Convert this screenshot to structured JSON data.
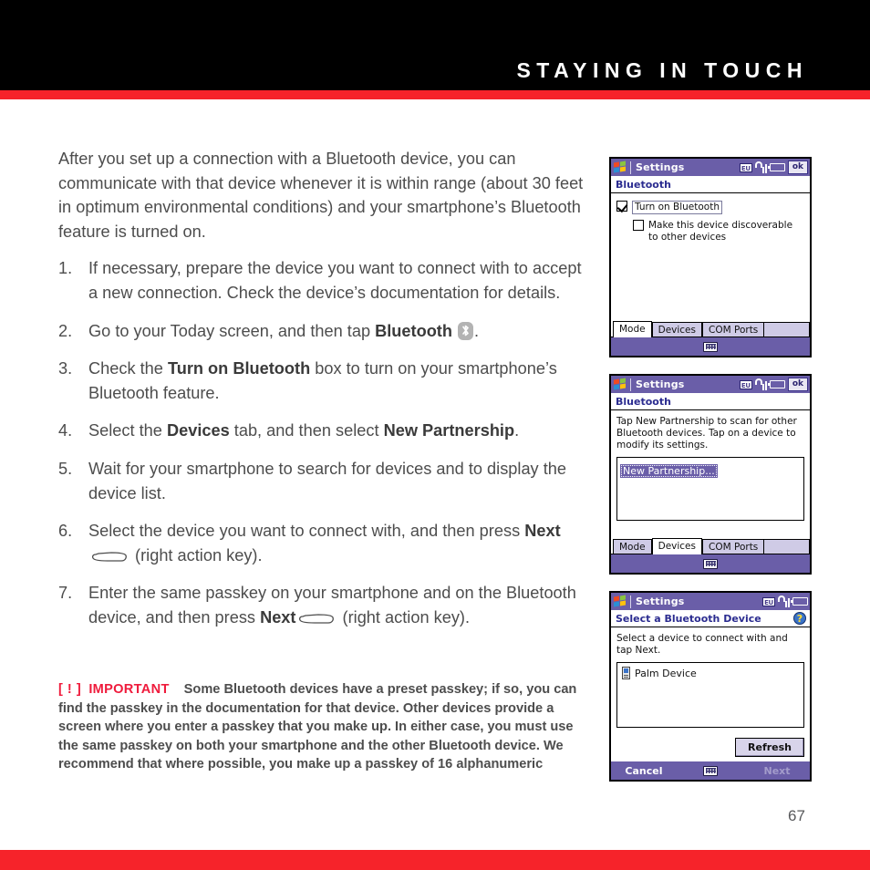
{
  "header": {
    "title": "STAYING IN TOUCH"
  },
  "footer": {
    "page_number": "67"
  },
  "colors": {
    "accent_red": "#f6232a",
    "note_red": "#ef1b3c",
    "pda_purple": "#6a5ea8",
    "body_gray": "#4d4d4d"
  },
  "body": {
    "intro": "After you set up a connection with a Bluetooth device, you can communicate with that device whenever it is within range (about 30 feet in optimum environmental conditions) and your smartphone’s Bluetooth feature is turned on.",
    "steps": [
      {
        "num": "1.",
        "part1": "If necessary, prepare the device you want to connect with to accept a new connection. Check the device’s documentation for details."
      },
      {
        "num": "2.",
        "part1": "Go to your Today screen, and then tap ",
        "bold1": "Bluetooth",
        "icon": "bluetooth-icon",
        "part2": "."
      },
      {
        "num": "3.",
        "part1": "Check the ",
        "bold1": "Turn on Bluetooth",
        "part2": " box to turn on your smartphone’s Bluetooth feature."
      },
      {
        "num": "4.",
        "part1": "Select the ",
        "bold1": "Devices",
        "part2": " tab, and then select ",
        "bold2": "New Partnership",
        "part3": "."
      },
      {
        "num": "5.",
        "part1": "Wait for your smartphone to search for devices and to display the device list."
      },
      {
        "num": "6.",
        "part1": "Select the device you want to connect with, and then press ",
        "bold1": "Next",
        "icon": "action-key-icon",
        "part2": " (right action key)."
      },
      {
        "num": "7.",
        "part1": "Enter the same passkey on your smartphone and on the Bluetooth device, and then press ",
        "bold1": "Next",
        "icon": "action-key-icon",
        "part2": " (right action key)."
      }
    ]
  },
  "note": {
    "bracket": "[ ! ]",
    "label": "IMPORTANT",
    "text": "Some Bluetooth devices have a preset passkey; if so, you can find the passkey in the documentation for that device. Other devices provide a screen where you enter a passkey that you make up. In either case, you must use the same passkey on both your smartphone and the other Bluetooth device. We recommend that where possible, you make up a passkey of 16 alphanumeric"
  },
  "screenshots": [
    {
      "id": "bluetooth-mode",
      "titlebar": {
        "app": "Settings",
        "icons": [
          "windows-logo-icon",
          "eu-badge-icon",
          "signal-icon",
          "battery-icon"
        ],
        "eu_label": "EU",
        "ok_label": "ok"
      },
      "subtitle": "Bluetooth",
      "checkboxes": [
        {
          "label": "Turn on Bluetooth",
          "checked": true,
          "focused": true
        },
        {
          "label": "Make this device discoverable to other devices",
          "checked": false,
          "focused": false
        }
      ],
      "tabs": [
        {
          "label": "Mode",
          "active": true
        },
        {
          "label": "Devices",
          "active": false
        },
        {
          "label": "COM Ports",
          "active": false
        }
      ],
      "softbar": {
        "center_icon": "keyboard-icon"
      }
    },
    {
      "id": "bluetooth-devices",
      "titlebar": {
        "app": "Settings",
        "eu_label": "EU",
        "ok_label": "ok"
      },
      "subtitle": "Bluetooth",
      "hint": "Tap New Partnership to scan for other Bluetooth devices. Tap on a device to modify its settings.",
      "list": [
        {
          "label": "New Partnership...",
          "selected": true
        }
      ],
      "tabs": [
        {
          "label": "Mode",
          "active": false
        },
        {
          "label": "Devices",
          "active": true
        },
        {
          "label": "COM Ports",
          "active": false
        }
      ],
      "softbar": {
        "center_icon": "keyboard-icon"
      }
    },
    {
      "id": "select-bluetooth-device",
      "titlebar": {
        "app": "Settings",
        "eu_label": "EU"
      },
      "subtitle": "Select a Bluetooth Device",
      "help_icon": "help-icon",
      "hint": "Select a device to connect with and tap Next.",
      "list": [
        {
          "label": "Palm Device",
          "icon": "device-icon",
          "selected": false
        }
      ],
      "button": "Refresh",
      "softbar": {
        "left": "Cancel",
        "center_icon": "keyboard-icon",
        "right": "Next"
      }
    }
  ]
}
